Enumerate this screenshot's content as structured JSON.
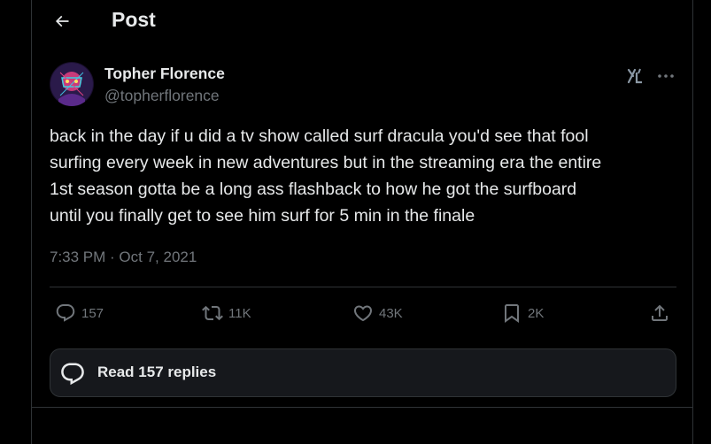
{
  "header": {
    "title": "Post",
    "back_icon": "arrow-left-icon"
  },
  "post": {
    "author": {
      "name": "Topher Florence",
      "handle": "@topherflorence",
      "avatar": "avatar-image"
    },
    "text": "back in the day if u did a tv show called surf dracula you'd see that fool\nsurfing every week in new adventures but in the streaming era the entire\n1st season gotta be a long ass flashback to how he got the surfboard\nuntil you finally get to see him surf for 5 min in the finale",
    "timestamp": "7:33 PM · Oct 7, 2021",
    "actions": {
      "replies": "157",
      "reposts": "11K",
      "likes": "43K",
      "bookmarks": "2K"
    }
  },
  "read_replies": {
    "label": "Read 157 replies"
  },
  "colors": {
    "background": "#000000",
    "text": "#e7e9ea",
    "muted": "#71767b",
    "border": "#2f3336"
  }
}
